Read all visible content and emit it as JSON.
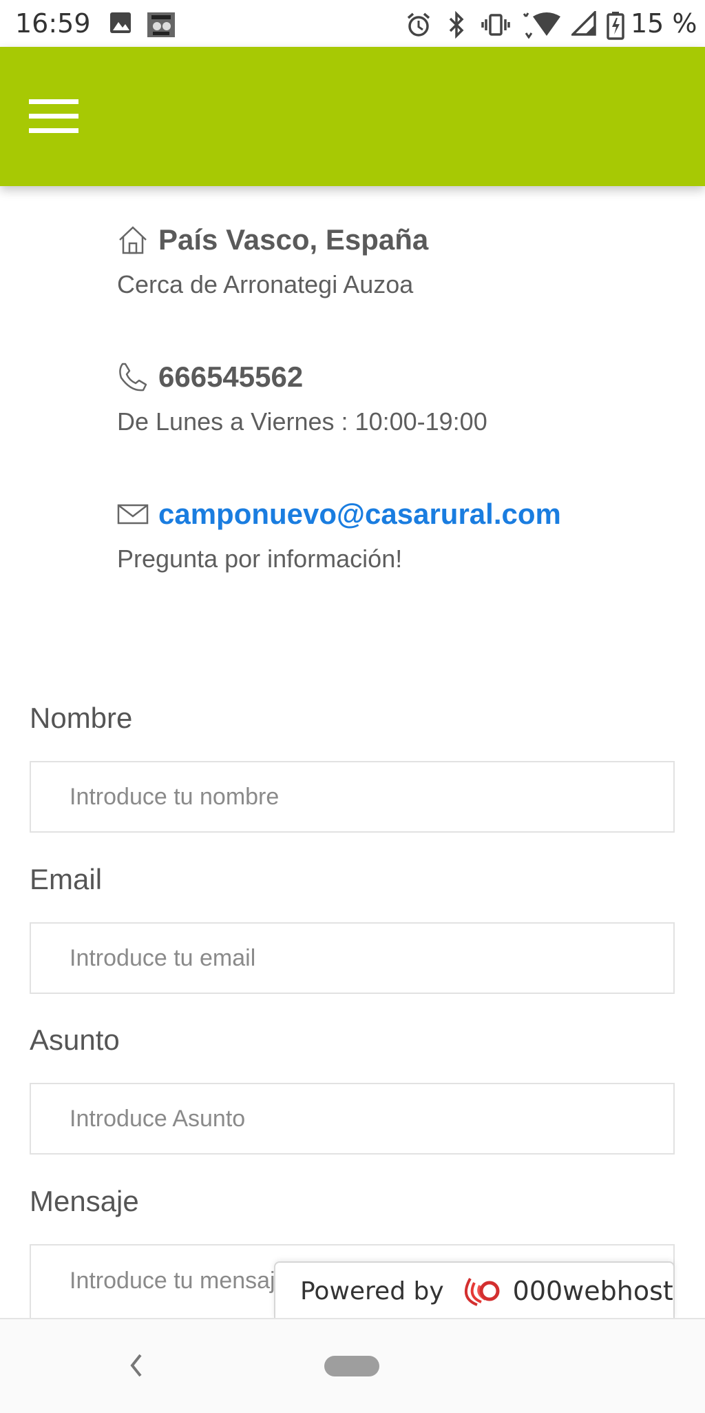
{
  "status_bar": {
    "time": "16:59",
    "battery": "15 %",
    "icons": [
      "image-icon",
      "app-notification-icon",
      "alarm-icon",
      "bluetooth-icon",
      "vibrate-icon",
      "wifi-icon",
      "signal-icon",
      "battery-charging-icon"
    ]
  },
  "header": {
    "menu_icon": "hamburger-menu-icon",
    "color": "#a7c904"
  },
  "contact": {
    "location": {
      "icon": "home-icon",
      "title": "País Vasco, España",
      "subtitle": "Cerca de Arronategi Auzoa"
    },
    "phone": {
      "icon": "phone-icon",
      "title": "666545562",
      "subtitle": "De Lunes a Viernes : 10:00-19:00"
    },
    "email": {
      "icon": "mail-icon",
      "title": "camponuevo@casarural.com",
      "subtitle": "Pregunta por información!",
      "link_color": "#1a7de0"
    }
  },
  "form": {
    "name": {
      "label": "Nombre",
      "placeholder": "Introduce tu nombre"
    },
    "email": {
      "label": "Email",
      "placeholder": "Introduce tu email"
    },
    "subject": {
      "label": "Asunto",
      "placeholder": "Introduce Asunto"
    },
    "message": {
      "label": "Mensaje",
      "placeholder": "Introduce tu mensaje"
    }
  },
  "powered_badge": {
    "prefix": "Powered by",
    "brand": "000webhost",
    "logo_icon": "000webhost-logo-icon"
  },
  "nav_bar": {
    "icons": [
      "back-icon",
      "home-pill-icon"
    ]
  }
}
